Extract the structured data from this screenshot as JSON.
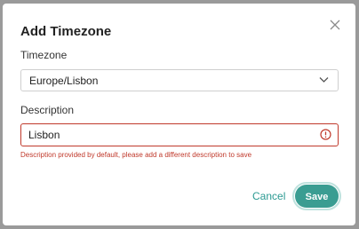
{
  "dialog": {
    "title": "Add Timezone",
    "timezone_label": "Timezone",
    "timezone_value": "Europe/Lisbon",
    "description_label": "Description",
    "description_value": "Lisbon",
    "description_error": "Description provided by default, please add a different description to save",
    "cancel_label": "Cancel",
    "save_label": "Save"
  },
  "icons": {
    "close": "close-icon",
    "chevron": "chevron-down-icon",
    "error": "error-circle-icon"
  },
  "colors": {
    "accent": "#3a9d92",
    "error": "#c0392b"
  }
}
